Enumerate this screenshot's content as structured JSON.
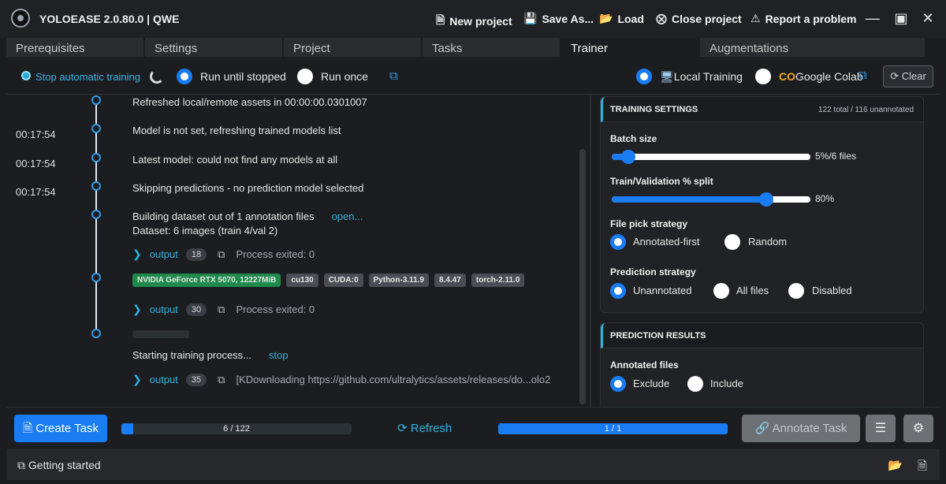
{
  "window": {
    "title": "YOLOEASE 2.0.80.0 | QWE",
    "menu": [
      {
        "icon": "file-icon",
        "label": "New project"
      },
      {
        "icon": "save-icon",
        "label": "Save As..."
      },
      {
        "icon": "folder-open-icon",
        "label": "Load"
      },
      {
        "icon": "close-circle-icon",
        "label": "Close project"
      },
      {
        "icon": "warning-icon",
        "label": "Report a problem"
      }
    ]
  },
  "tabs": [
    {
      "label": "Prerequisites",
      "active": false
    },
    {
      "label": "Settings",
      "active": false
    },
    {
      "label": "Project",
      "active": false
    },
    {
      "label": "Tasks",
      "active": false
    },
    {
      "label": "Trainer",
      "active": true
    },
    {
      "label": "Augmentations",
      "active": false
    }
  ],
  "toolbar": {
    "stop_auto": "Stop automatic training",
    "run_until_stopped": "Run until stopped",
    "run_once": "Run once",
    "local_training": "Local Training",
    "google_colab": "Google Colab",
    "clear": "Clear"
  },
  "log": {
    "entries": [
      {
        "time": "",
        "message": "Refreshed local/remote assets in 00:00:00.0301007"
      },
      {
        "time": "00:17:54",
        "message": "Model is not set, refreshing trained models list"
      },
      {
        "time": "00:17:54",
        "message": "Latest model: could not find any models at all"
      },
      {
        "time": "00:17:54",
        "message": "Skipping predictions - no prediction model selected"
      }
    ],
    "dataset_message": "Building dataset out of 1 annotation files",
    "dataset_link": "open...",
    "dataset_detail": "Dataset: 6 images (train 4/val 2)",
    "output_label": "output",
    "output1": {
      "count": "18",
      "status": "Process exited: 0"
    },
    "badges": [
      "NVIDIA GeForce RTX 5070, 12227MiB",
      "cu130",
      "CUDA:0",
      "Python-3.11.9",
      "8.4.47",
      "torch-2.11.0"
    ],
    "output2": {
      "count": "30",
      "status": "Process exited: 0"
    },
    "training_message": "Starting training process...",
    "stop_link": "stop",
    "output3": {
      "count": "35",
      "status": "[KDownloading https://github.com/ultralytics/assets/releases/do...olo2"
    }
  },
  "training_settings": {
    "title": "TRAINING SETTINGS",
    "meta": "122 total / 116 unannotated",
    "batch_label": "Batch size",
    "batch_value_text": "5%/6 files",
    "batch_value": 0.05,
    "split_label": "Train/Validation % split",
    "split_value_text": "80%",
    "split_value": 0.8,
    "pick_label": "File pick strategy",
    "pick_options": [
      "Annotated-first",
      "Random"
    ],
    "pred_label": "Prediction strategy",
    "pred_options": [
      "Unannotated",
      "All files",
      "Disabled"
    ]
  },
  "prediction_results": {
    "title": "PREDICTION RESULTS",
    "annotated_label": "Annotated files",
    "options": [
      "Exclude",
      "Include"
    ]
  },
  "actions": {
    "create_task": "Create Task",
    "progress1_text": "6 / 122",
    "progress1_value": 0.05,
    "refresh": "Refresh",
    "progress2_text": "1 / 1",
    "progress2_value": 1.0,
    "annotate_task": "Annotate Task"
  },
  "status": {
    "getting_started": "Getting started"
  },
  "colors": {
    "accent": "#1a7cf2",
    "link": "#2fb3dc",
    "gpu_badge": "#1f8a4c"
  }
}
